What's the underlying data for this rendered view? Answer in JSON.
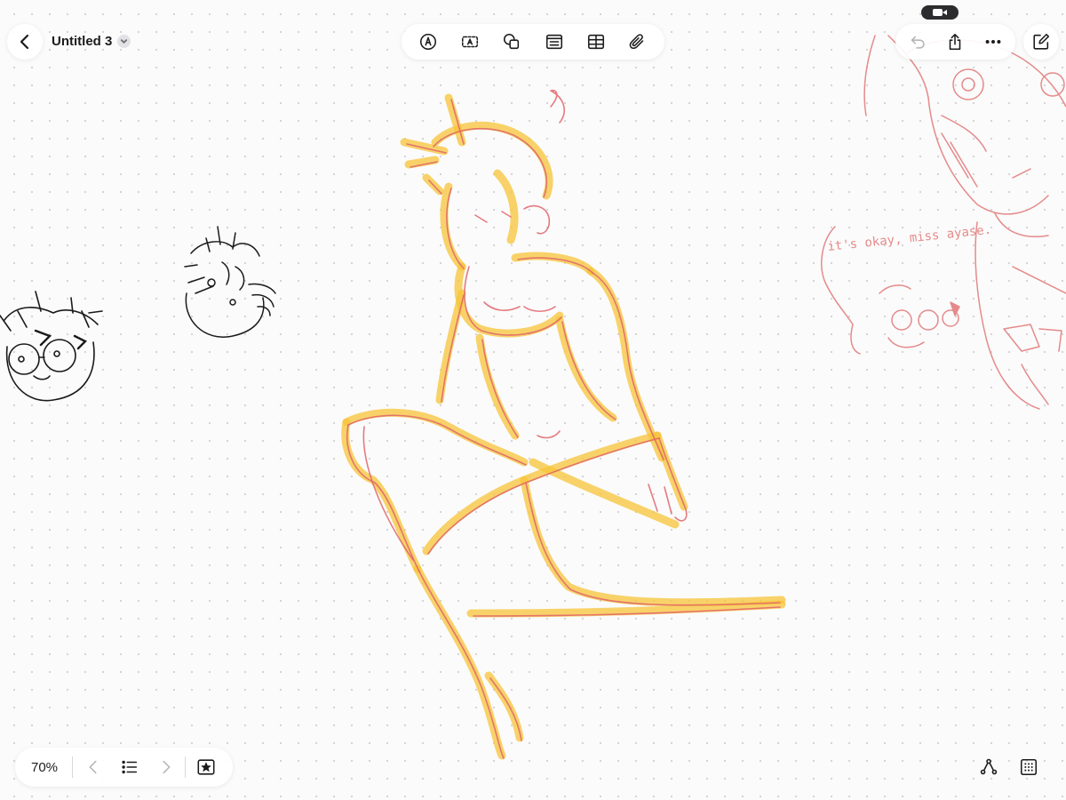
{
  "toolbar_left": {
    "back_icon": "chevron-left-icon",
    "title": "Untitled 3",
    "title_menu_icon": "chevron-down-icon"
  },
  "toolbar_center": {
    "tools": [
      {
        "name": "markup-pen-tool",
        "icon": "pen-circle-icon"
      },
      {
        "name": "text-box-tool",
        "icon": "text-box-icon"
      },
      {
        "name": "shapes-tool",
        "icon": "shapes-icon"
      },
      {
        "name": "sticky-note-tool",
        "icon": "note-icon"
      },
      {
        "name": "table-tool",
        "icon": "table-icon"
      },
      {
        "name": "attachment-tool",
        "icon": "paperclip-icon"
      }
    ]
  },
  "toolbar_right": {
    "undo_icon": "undo-icon",
    "share_icon": "share-icon",
    "more_icon": "ellipsis-icon",
    "new_board_icon": "compose-icon",
    "camera_indicator_icon": "camera-icon"
  },
  "bottom_left": {
    "zoom": "70%",
    "prev_icon": "chevron-left-icon",
    "list_icon": "list-icon",
    "next_icon": "chevron-right-icon",
    "favorites_icon": "star-box-icon"
  },
  "bottom_right": {
    "connector_icon": "connector-icon",
    "grid_icon": "grid-icon"
  },
  "canvas": {
    "note_text": "it's okay, miss ayase.",
    "colors": {
      "black_ink": "#1a1a1a",
      "yellow_ink": "#f7c438",
      "red_ink": "#e0646a",
      "pink_ink": "#e58a8a"
    }
  }
}
